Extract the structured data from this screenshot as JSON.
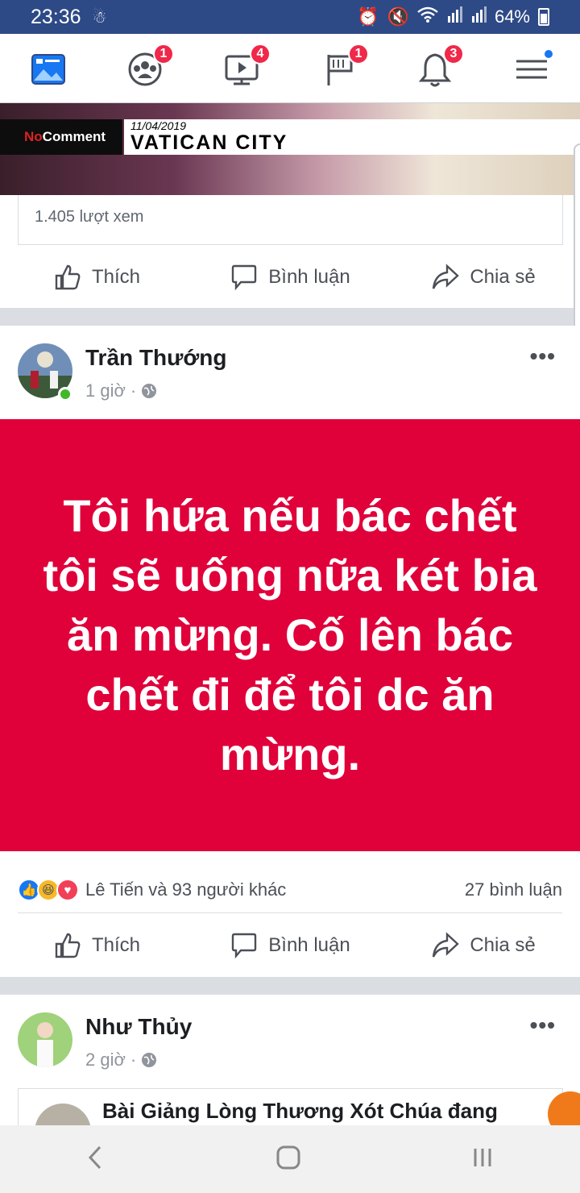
{
  "status_bar": {
    "time": "23:36",
    "battery": "64%"
  },
  "navbar": {
    "items": [
      {
        "name": "news-feed",
        "badge": ""
      },
      {
        "name": "groups",
        "badge": "1"
      },
      {
        "name": "watch",
        "badge": "4"
      },
      {
        "name": "pages",
        "badge": "1"
      },
      {
        "name": "notifications",
        "badge": "3"
      },
      {
        "name": "menu",
        "badge": ""
      }
    ]
  },
  "video_post": {
    "overlay_brand_no": "No",
    "overlay_brand_comment": "Comment",
    "overlay_date": "11/04/2019",
    "overlay_location": "VATICAN CITY",
    "views": "1.405 lượt xem"
  },
  "actions": {
    "like": "Thích",
    "comment": "Bình luận",
    "share": "Chia sẻ"
  },
  "post1": {
    "author": "Trần Thướng",
    "time": "1 giờ",
    "text": "Tôi hứa nếu bác chết tôi sẽ uống nữa két bia ăn mừng. Cố lên bác chết đi để tôi dc ăn mừng.",
    "reactions_text": "Lê Tiến và 93 người khác",
    "comments_text": "27 bình luận"
  },
  "post2": {
    "author": "Như Thủy",
    "time": "2 giờ",
    "shared_title": "Bài Giảng Lòng Thương Xót Chúa đang"
  },
  "colors": {
    "brand": "#2d4a86",
    "badge": "#f02849",
    "post_bg": "#e0003a"
  }
}
